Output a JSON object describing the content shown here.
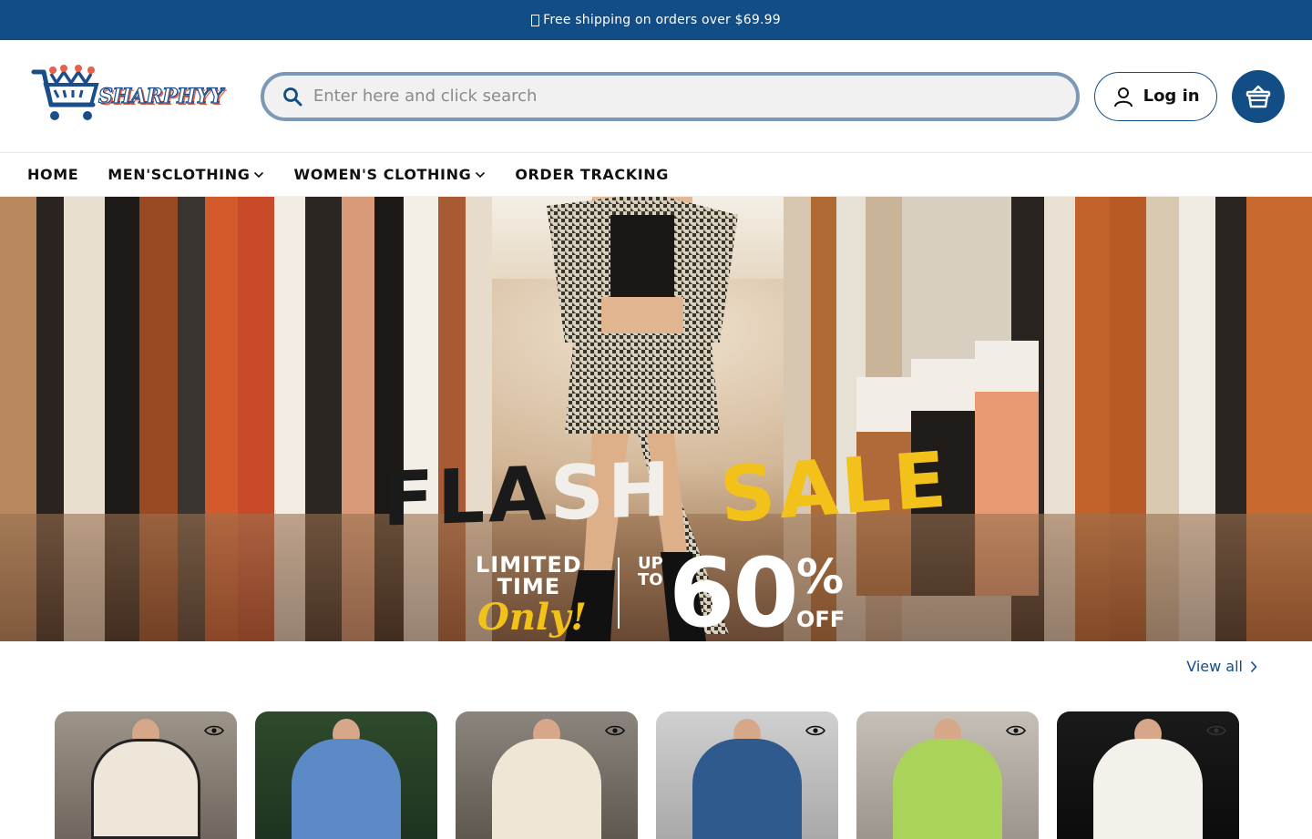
{
  "announcement": {
    "text": "Free shipping on orders over $69.99",
    "icon": "gift-icon"
  },
  "header": {
    "logo_text": "SHARPHYY",
    "search_placeholder": "Enter here and click search",
    "login_label": "Log in",
    "cart_icon": "basket-icon"
  },
  "nav": {
    "items": [
      {
        "label": "HOME",
        "dropdown": false
      },
      {
        "label": "MEN'SCLOTHING",
        "dropdown": true
      },
      {
        "label": "WOMEN'S CLOTHING",
        "dropdown": true
      },
      {
        "label": "ORDER TRACKING",
        "dropdown": false
      }
    ]
  },
  "hero": {
    "flash_a": "FLA",
    "flash_b": "SH",
    "sale": "SALE",
    "limited_1": "LIMITED",
    "limited_2": "TIME",
    "only": "Only!",
    "up": "UP",
    "to": "TO",
    "percent": "60",
    "percent_sign": "%",
    "off": "OFF"
  },
  "collection": {
    "view_all": "View all",
    "products": [
      {
        "name": "product-1",
        "bg": "#8a8278",
        "garment": "#efe6da"
      },
      {
        "name": "product-2",
        "bg": "#2f4a2c",
        "garment": "#5b8ac7"
      },
      {
        "name": "product-3",
        "bg": "#7a736c",
        "garment": "#f0e6d6"
      },
      {
        "name": "product-4",
        "bg": "#c8c8c8",
        "garment": "#2e5a8e"
      },
      {
        "name": "product-5",
        "bg": "#bdb6ad",
        "garment": "#a9d35a"
      },
      {
        "name": "product-6",
        "bg": "#121212",
        "garment": "#f4f1ea"
      }
    ]
  },
  "colors": {
    "brand": "#134d86",
    "accent": "#f2c21a",
    "search_border": "#7d97b6"
  }
}
